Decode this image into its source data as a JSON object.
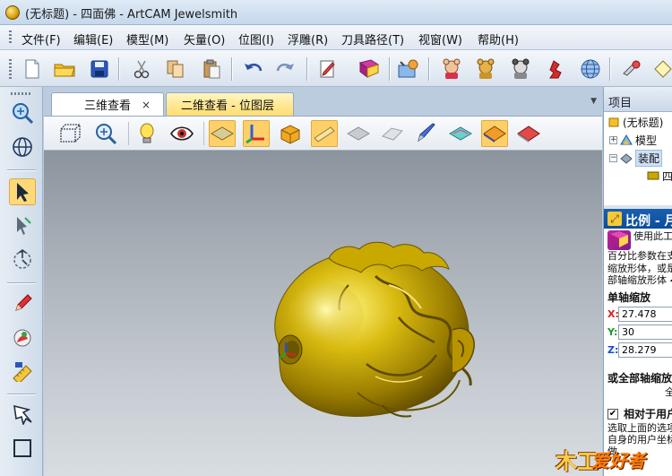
{
  "window": {
    "title": "(无标题) - 四面佛 - ArtCAM Jewelsmith"
  },
  "menu": {
    "items": [
      "文件(F)",
      "编辑(E)",
      "模型(M)",
      "矢量(O)",
      "位图(I)",
      "浮雕(R)",
      "刀具路径(T)",
      "视窗(W)",
      "帮助(H)"
    ]
  },
  "main_toolbar": {
    "icons": [
      "new-file-icon",
      "open-folder-icon",
      "save-icon",
      "cut-icon",
      "copy-icon",
      "paste-icon",
      "undo-icon",
      "redo-icon",
      "edit-notes-icon",
      "book-icon",
      "settings-icon",
      "bear-red-icon",
      "bear-yellow-icon",
      "bear-grey-icon",
      "figure-red-icon",
      "globe-icon",
      "wrench-icon",
      "diamond-icon"
    ]
  },
  "tabs": {
    "items": [
      {
        "label": "三维查看",
        "close": "×"
      },
      {
        "label": "二维查看 - 位图层"
      }
    ]
  },
  "view_toolbar": {
    "icons": [
      "box-view-icon",
      "zoom-icon",
      "bulb-icon",
      "eye-icon",
      "plane-icon",
      "axis-icon",
      "box-icon",
      "slab-icon",
      "mesh-icon",
      "wireframe-icon",
      "paint-brush-icon",
      "layer-icon",
      "layer-orange-icon",
      "layer-red-icon"
    ]
  },
  "left_toolbar": {
    "icons": [
      "zoom-view-icon",
      "globe-view-icon",
      "select-arrow-icon",
      "node-edit-icon",
      "transform-icon",
      "pencil-icon",
      "paint-icon",
      "measure-icon",
      "vector-icon",
      "rectangle-icon"
    ]
  },
  "project_panel": {
    "title": "项目",
    "tree": [
      {
        "label": "(无标题)"
      },
      {
        "label": "模型"
      },
      {
        "label": "装配"
      },
      {
        "label": "四"
      }
    ]
  },
  "scale_panel": {
    "title": "比例 - 月",
    "description_lines": [
      "使用此工",
      "百分比参数在支",
      "缩放形体，或是",
      "部轴缩放形体 ◀"
    ],
    "single_axis_title": "单轴缩放",
    "x": {
      "label": "X:",
      "value": "27.478"
    },
    "y": {
      "label": "Y:",
      "value": "30"
    },
    "z": {
      "label": "Z:",
      "value": "28.279"
    },
    "all_axes_title": "或全部轴缩放",
    "all_axes_sub": "全",
    "checkbox_label": "相对于用户",
    "checkbox_checked": "✔",
    "footer_lines": [
      "选取上面的选项",
      "自身的用户坐标",
      "做..."
    ]
  },
  "watermark": {
    "left": "木工",
    "right": "爱好者"
  },
  "colors": {
    "model_gold": "#c9a800",
    "tab_active_yellow": "#ffdc6e",
    "panel_blue": "#0b4d9b"
  }
}
